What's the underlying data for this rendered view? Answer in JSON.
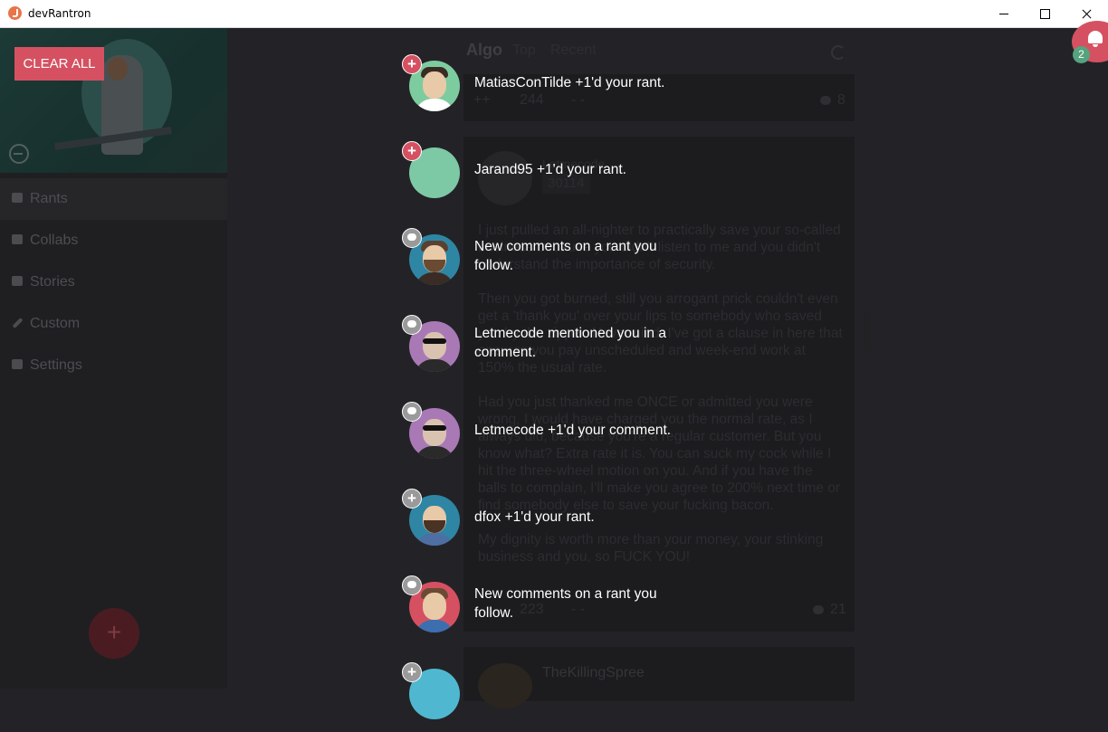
{
  "window": {
    "title": "devRantron"
  },
  "sidebar": {
    "clear_all_label": "CLEAR ALL",
    "items": [
      {
        "label": "Rants",
        "icon": "rants-icon"
      },
      {
        "label": "Collabs",
        "icon": "collabs-icon"
      },
      {
        "label": "Stories",
        "icon": "stories-icon"
      },
      {
        "label": "Custom",
        "icon": "pencil-icon"
      },
      {
        "label": "Settings",
        "icon": "wrench-icon"
      }
    ],
    "fab_label": "+"
  },
  "feed": {
    "tabs": [
      "Algo",
      "Top",
      "Recent"
    ],
    "rant1": {
      "upvote": "++",
      "score": "244",
      "downvote": "- -",
      "comments": "8"
    },
    "rant2": {
      "username": "Letmecode",
      "user_score": "30114",
      "text": "I just pulled an all-nighter to practically save your so-called business because you didn't listen to me and you didn't understand the importance of security.\n\nThen you got burned, still you arrogant prick couldn't even get a 'thank you' over your lips to somebody who saved you by the zipper. Nevermind, I've got a clause in here that ensures you pay unscheduled and week-end work at 150% the usual rate.\n\nHad you just thanked me ONCE or admitted you were wrong, I would have charged you the normal rate, as I always did, because you're a regular customer. But you know what? Extra rate it is. You can suck my cock while I hit the three-wheel motion on you. And if you have the balls to complain, I'll make you agree to 200% next time or find somebody else to save your fucking bacon.\n\nMy dignity is worth more than your money, your stinking business and you, so FUCK YOU!",
      "score": "223",
      "downvote": "- -",
      "comments": "21"
    },
    "rant3": {
      "username": "TheKillingSpree"
    }
  },
  "notifications": {
    "badge_count": "2",
    "items": [
      {
        "text": "MatiasConTilde +1'd your rant.",
        "type": "plus"
      },
      {
        "text": "Jarand95 +1'd your rant.",
        "type": "plus"
      },
      {
        "text": "New comments on a rant you follow.",
        "type": "comment"
      },
      {
        "text": "Letmecode mentioned you in a comment.",
        "type": "comment"
      },
      {
        "text": "Letmecode +1'd your comment.",
        "type": "comment"
      },
      {
        "text": "dfox +1'd your rant.",
        "type": "plus-read"
      },
      {
        "text": "New comments on a rant you follow.",
        "type": "comment"
      }
    ]
  },
  "colors": {
    "accent": "#d55161",
    "badge": "#55a37f",
    "background": "#232327"
  }
}
